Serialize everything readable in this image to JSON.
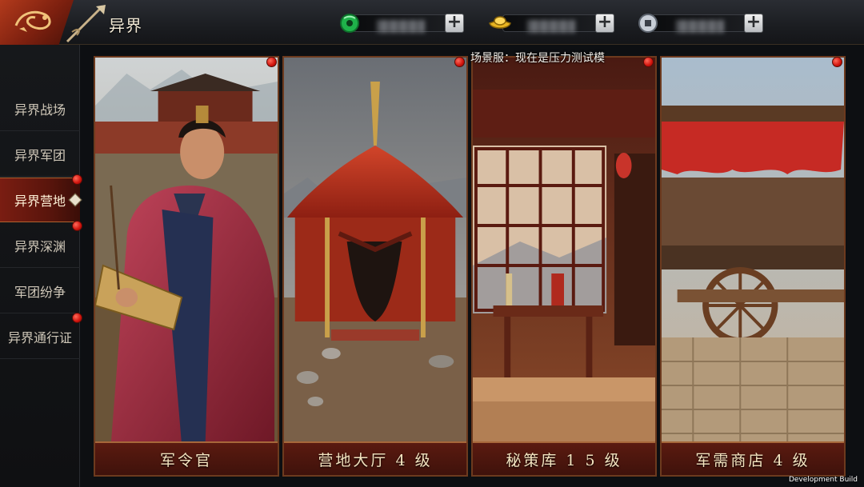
{
  "header": {
    "title": "异界",
    "resources": [
      {
        "name": "jade",
        "icon": "jade-icon",
        "plus": "+"
      },
      {
        "name": "gold-ingot",
        "icon": "gold-ingot-icon",
        "plus": "+"
      },
      {
        "name": "coin",
        "icon": "copper-coin-icon",
        "plus": "+"
      }
    ]
  },
  "sidebar": {
    "items": [
      {
        "label": "异界战场",
        "active": false
      },
      {
        "label": "异界军团",
        "active": false
      },
      {
        "label": "异界营地",
        "active": true
      },
      {
        "label": "异界深渊",
        "active": false
      },
      {
        "label": "军团纷争",
        "active": false
      },
      {
        "label": "异界通行证",
        "active": false
      }
    ]
  },
  "notice": "场景服：现在是压力测试模",
  "cards": [
    {
      "label": "军令官"
    },
    {
      "label": "营地大厅 4 级"
    },
    {
      "label": "秘策库 1 5 级"
    },
    {
      "label": "军需商店 4 级"
    }
  ],
  "footer": {
    "build": "Development Build"
  },
  "colors": {
    "accent": "#7a1d12",
    "badge": "#d0130c",
    "gold": "#f4e4c0"
  }
}
